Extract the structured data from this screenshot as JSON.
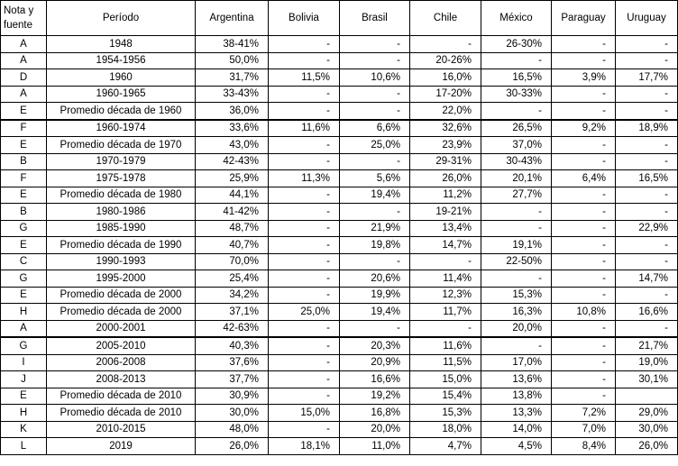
{
  "headers": [
    "Nota y fuente",
    "Período",
    "Argentina",
    "Bolivia",
    "Brasil",
    "Chile",
    "México",
    "Paraguay",
    "Uruguay"
  ],
  "rows": [
    [
      "A",
      "1948",
      "38-41%",
      "-",
      "-",
      "-",
      "26-30%",
      "-",
      "-"
    ],
    [
      "A",
      "1954-1956",
      "50,0%",
      "-",
      "-",
      "20-26%",
      "-",
      "-",
      "-"
    ],
    [
      "D",
      "1960",
      "31,7%",
      "11,5%",
      "10,6%",
      "16,0%",
      "16,5%",
      "3,9%",
      "17,7%"
    ],
    [
      "A",
      "1960-1965",
      "33-43%",
      "-",
      "-",
      "17-20%",
      "30-33%",
      "-",
      "-"
    ],
    [
      "E",
      "Promedio década de 1960",
      "36,0%",
      "-",
      "-",
      "22,0%",
      "-",
      "-",
      "-"
    ],
    [
      "F",
      "1960-1974",
      "33,6%",
      "11,6%",
      "6,6%",
      "32,6%",
      "26,5%",
      "9,2%",
      "18,9%"
    ],
    [
      "E",
      "Promedio década de 1970",
      "43,0%",
      "-",
      "25,0%",
      "23,9%",
      "37,0%",
      "-",
      "-"
    ],
    [
      "B",
      "1970-1979",
      "42-43%",
      "-",
      "-",
      "29-31%",
      "30-43%",
      "-",
      "-"
    ],
    [
      "F",
      "1975-1978",
      "25,9%",
      "11,3%",
      "5,6%",
      "26,0%",
      "20,1%",
      "6,4%",
      "16,5%"
    ],
    [
      "E",
      "Promedio década de 1980",
      "44,1%",
      "-",
      "19,4%",
      "11,2%",
      "27,7%",
      "-",
      "-"
    ],
    [
      "B",
      "1980-1986",
      "41-42%",
      "-",
      "-",
      "19-21%",
      "-",
      "-",
      "-"
    ],
    [
      "G",
      "1985-1990",
      "48,7%",
      "-",
      "21,9%",
      "13,4%",
      "-",
      "-",
      "22,9%"
    ],
    [
      "E",
      "Promedio década de 1990",
      "40,7%",
      "-",
      "19,8%",
      "14,7%",
      "19,1%",
      "-",
      "-"
    ],
    [
      "C",
      "1990-1993",
      "70,0%",
      "-",
      "-",
      "-",
      "22-50%",
      "-",
      "-"
    ],
    [
      "G",
      "1995-2000",
      "25,4%",
      "-",
      "20,6%",
      "11,4%",
      "-",
      "-",
      "14,7%"
    ],
    [
      "E",
      "Promedio década de 2000",
      "34,2%",
      "-",
      "19,9%",
      "12,3%",
      "15,3%",
      "-",
      "-"
    ],
    [
      "H",
      "Promedio década de 2000",
      "37,1%",
      "25,0%",
      "19,4%",
      "11,7%",
      "16,3%",
      "10,8%",
      "16,6%"
    ],
    [
      "A",
      "2000-2001",
      "42-63%",
      "-",
      "-",
      "-",
      "20,0%",
      "-",
      "-"
    ],
    [
      "G",
      "2005-2010",
      "40,3%",
      "-",
      "20,3%",
      "11,6%",
      "-",
      "-",
      "21,7%"
    ],
    [
      "I",
      "2006-2008",
      "37,6%",
      "-",
      "20,9%",
      "11,5%",
      "17,0%",
      "-",
      "19,0%"
    ],
    [
      "J",
      "2008-2013",
      "37,7%",
      "-",
      "16,6%",
      "15,0%",
      "13,6%",
      "-",
      "30,1%"
    ],
    [
      "E",
      "Promedio década de 2010",
      "30,9%",
      "-",
      "19,2%",
      "15,4%",
      "13,8%",
      "-",
      ""
    ],
    [
      "H",
      "Promedio década de 2010",
      "30,0%",
      "15,0%",
      "16,8%",
      "15,3%",
      "13,3%",
      "7,2%",
      "29,0%"
    ],
    [
      "K",
      "2010-2015",
      "48,0%",
      "-",
      "20,0%",
      "18,0%",
      "14,0%",
      "7,0%",
      "30,0%"
    ],
    [
      "L",
      "2019",
      "26,0%",
      "18,1%",
      "11,0%",
      "4,7%",
      "4,5%",
      "8,4%",
      "26,0%"
    ]
  ],
  "thick_top_rows": [
    5,
    18
  ]
}
